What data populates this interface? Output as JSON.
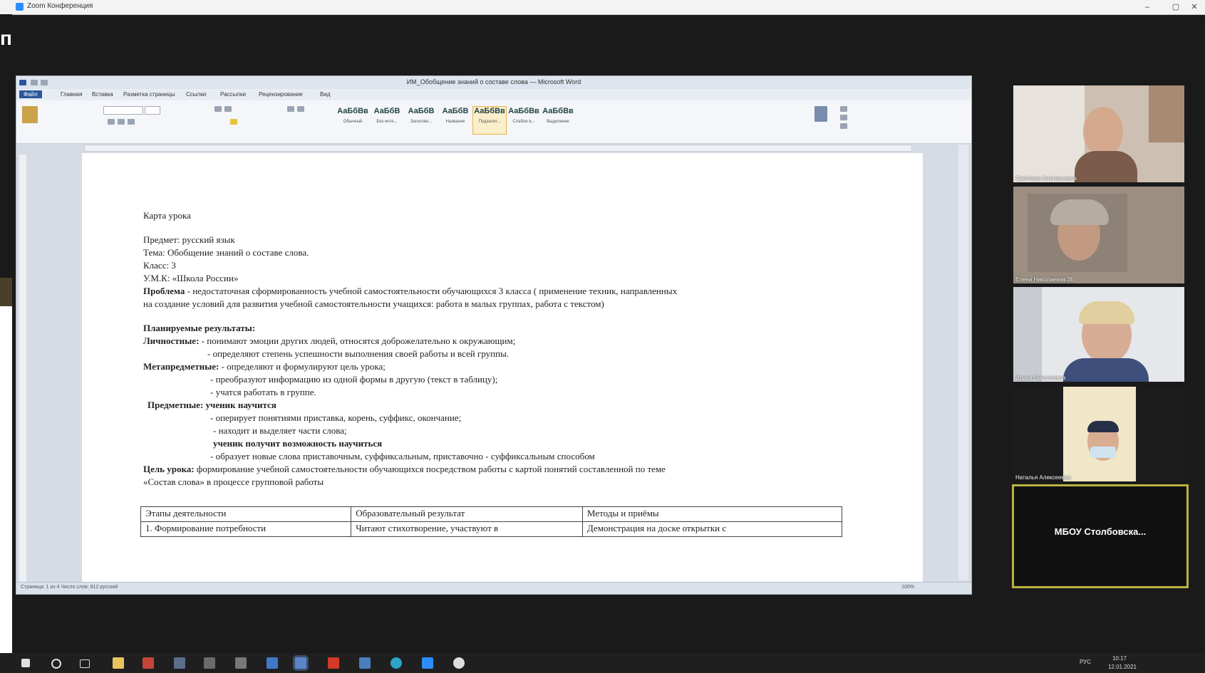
{
  "zoom": {
    "window_title": "Zoom Конференция",
    "min": "–",
    "max": "▢",
    "close": "✕"
  },
  "share_letter": "п",
  "word": {
    "title": "ИМ_Обобщение знаний о составе слова — Microsoft Word",
    "tabs": [
      "Файл",
      "Главная",
      "Вставка",
      "Разметка страницы",
      "Ссылки",
      "Рассылки",
      "Рецензирование",
      "Вид"
    ],
    "styles": [
      {
        "sample": "АаБбВв",
        "name": "Обычный"
      },
      {
        "sample": "АаБбВ",
        "name": "Без инте..."
      },
      {
        "sample": "АаБбВ",
        "name": "Заголово..."
      },
      {
        "sample": "АаБбВ",
        "name": "Название"
      },
      {
        "sample": "АаБбВв",
        "name": "Подзагол..."
      },
      {
        "sample": "АаБбВв",
        "name": "Слабое в..."
      },
      {
        "sample": "АаБбВв",
        "name": "Выделение"
      }
    ],
    "status_left": "Страница: 1 из 4   Число слов: 812   русский",
    "status_right": "100%"
  },
  "document": {
    "heading": "Карта урока",
    "lines": [
      {
        "text": "Предмет: русский язык",
        "bold": false,
        "indent": 0
      },
      {
        "text": "Тема: Обобщение знаний о составе слова.",
        "bold": false,
        "indent": 0
      },
      {
        "text": "Класс: 3",
        "bold": false,
        "indent": 0
      },
      {
        "text": "У.М.К: «Школа России»",
        "bold": false,
        "indent": 0
      }
    ],
    "problem_label": "Проблема",
    "problem_text": " - недостаточная сформированность учебной самостоятельности обучающихся 3 класса ( применение техник, направленных",
    "problem_text2": "на создание условий для развития учебной самостоятельности учащихся: работа в малых группах, работа с текстом)",
    "planned_heading": "Планируемые результаты:",
    "personal_label": "Личностные:",
    "personal_1": " - понимают эмоции других людей, относятся доброжелательно к окружающим;",
    "personal_2": "- определяют степень успешности выполнения своей работы и всей группы.",
    "meta_label": "Метапредметные:",
    "meta_1": " - определяют и формулируют цель урока;",
    "meta_2": "- преобразуют информацию из одной формы в другую (текст в таблицу);",
    "meta_3": "- учатся работать в группе.",
    "subject_label": "Предметные: ученик научится",
    "subject_1": "- оперирует понятиями приставка, корень, суффикс, окончание;",
    "subject_2": "- находит и выделяет части слова;",
    "subject_3": "ученик получит возможность научиться",
    "subject_4": "- образует новые слова приставочным, суффиксальным, приставочно - суффиксальным способом",
    "goal_label": "Цель урока:",
    "goal_text": " формирование учебной самостоятельности обучающихся посредством работы с картой понятий составленной по теме",
    "goal_text2": "«Состав слова» в процессе групповой работы",
    "table_headers": [
      "Этапы деятельности",
      "Образовательный результат",
      "Методы и приёмы"
    ],
    "table_row1": [
      "1. Формирование потребности",
      "Читают стихотворение, участвуют в",
      "Демонстрация на доске открытки с"
    ]
  },
  "participants": [
    {
      "name": "Светлана Анатольевна"
    },
    {
      "name": "Елена Николаевна 3Б"
    },
    {
      "name": "Ирина Николаевна"
    },
    {
      "name": "Наталья Алексеевна"
    },
    {
      "name": "МБОУ Столбовска..."
    }
  ],
  "taskbar": {
    "tray_lang": "РУС",
    "time": "10:17",
    "date": "12.01.2021"
  }
}
